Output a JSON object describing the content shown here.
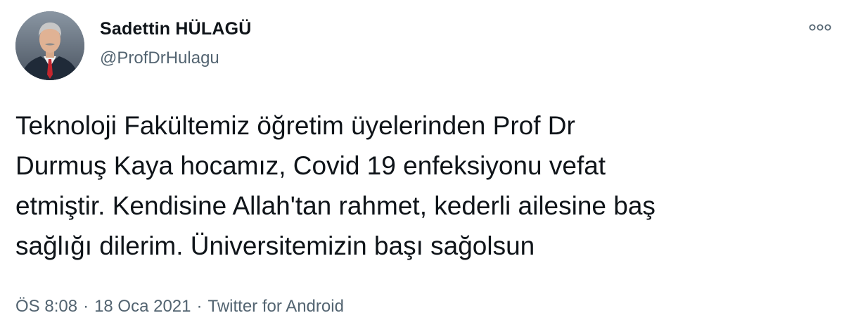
{
  "author": {
    "name": "Sadettin HÜLAGÜ",
    "handle": "@ProfDrHulagu"
  },
  "tweet": {
    "lines": [
      "Teknoloji Fakültemiz öğretim üyelerinden Prof Dr",
      "Durmuş Kaya hocamız, Covid 19 enfeksiyonu vefat",
      "etmiştir. Kendisine Allah'tan rahmet, kederli ailesine baş",
      "sağlığı dilerim. Üniversitemizin başı sağolsun"
    ]
  },
  "meta": {
    "time": "ÖS 8:08",
    "separator": "·",
    "date": "18 Oca 2021",
    "source": "Twitter for Android"
  },
  "icons": {
    "more": "more-options-icon",
    "avatar": "profile-photo"
  },
  "colors": {
    "text": "#0f1419",
    "secondary": "#536471",
    "background": "#ffffff"
  }
}
